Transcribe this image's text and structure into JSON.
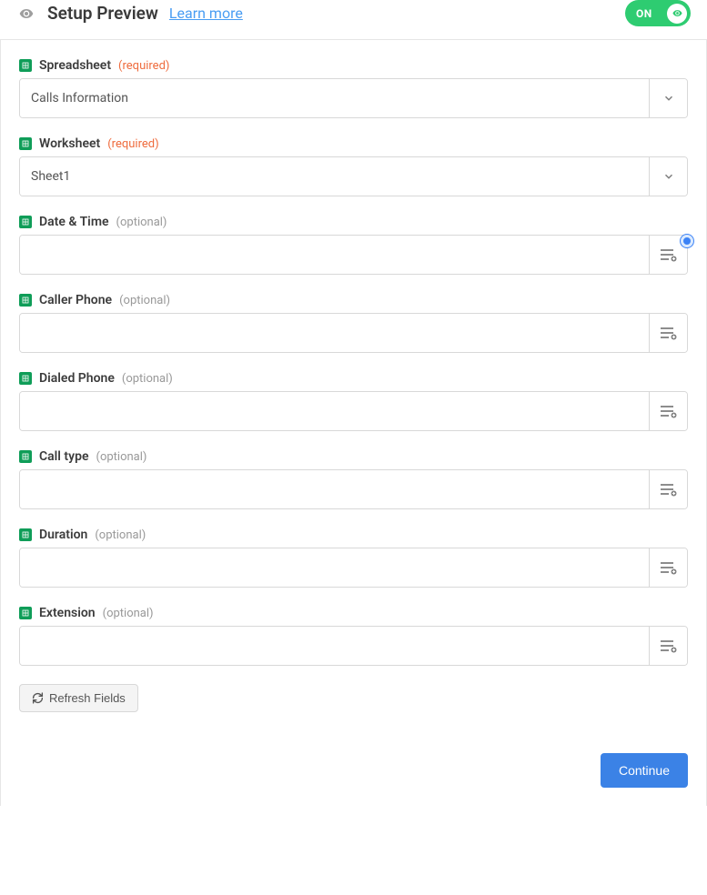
{
  "header": {
    "title": "Setup Preview",
    "learn_more": "Learn more",
    "toggle_label": "ON"
  },
  "fields": {
    "spreadsheet": {
      "label": "Spreadsheet",
      "badge": "(required)",
      "value": "Calls Information"
    },
    "worksheet": {
      "label": "Worksheet",
      "badge": "(required)",
      "value": "Sheet1"
    },
    "date_time": {
      "label": "Date & Time",
      "badge": "(optional)",
      "value": ""
    },
    "caller_phone": {
      "label": "Caller Phone",
      "badge": "(optional)",
      "value": ""
    },
    "dialed_phone": {
      "label": "Dialed Phone",
      "badge": "(optional)",
      "value": ""
    },
    "call_type": {
      "label": "Call type",
      "badge": "(optional)",
      "value": ""
    },
    "duration": {
      "label": "Duration",
      "badge": "(optional)",
      "value": ""
    },
    "extension": {
      "label": "Extension",
      "badge": "(optional)",
      "value": ""
    }
  },
  "actions": {
    "refresh": "Refresh Fields",
    "continue": "Continue"
  }
}
